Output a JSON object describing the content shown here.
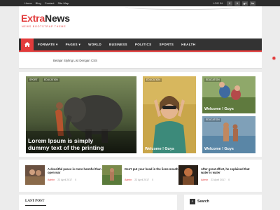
{
  "topbar": {
    "links": [
      "Home",
      "Blog",
      "Contact",
      "Site Map"
    ],
    "login_label": "LOG IN",
    "social": [
      "f",
      "t",
      "g+",
      "in"
    ]
  },
  "header": {
    "logo_part1": "Extra",
    "logo_part2": "News",
    "tagline": "NEWS BOOTSTRAP THEME"
  },
  "nav": {
    "home_icon": "home-icon",
    "items": [
      "FORMATE ▾",
      "PAGES ▾",
      "WORLD",
      "BUSINESS",
      "POLITICS",
      "SPORTS",
      "HEALTH"
    ]
  },
  "ticker": {
    "text": "Belajar Styling List Dengan CSS"
  },
  "featured": {
    "main": {
      "tags": [
        "SPORT",
        "EDUCATION"
      ],
      "caption": "Lorem Ipsum is simply dummy text of the printing"
    },
    "mid": {
      "tag": "EDUCATION",
      "caption": "Welcome ! Guys"
    },
    "top_right": {
      "tag": "EDUCATION",
      "caption": "Welcome ! Guys"
    },
    "bottom_right": {
      "tag": "EDUCATION",
      "caption": "Welcome ! Guys"
    }
  },
  "posts": [
    {
      "title": "A deceitful peace is more harmful than open war",
      "author": "Admin",
      "date": "23 April 2017",
      "comments": "0"
    },
    {
      "title": "Don't put your head in the lions mouth",
      "author": "Admin",
      "date": "23 April 2017",
      "comments": "0"
    },
    {
      "title": "After great effort, he explained that water is water",
      "author": "Admin",
      "date": "23 April 2017",
      "comments": "0"
    }
  ],
  "bottom": {
    "last_post": "LAST POST",
    "search": "Search"
  },
  "colors": {
    "accent": "#e23b3b",
    "nav_bg": "#333333",
    "topbar_bg": "#2c2c2c"
  }
}
